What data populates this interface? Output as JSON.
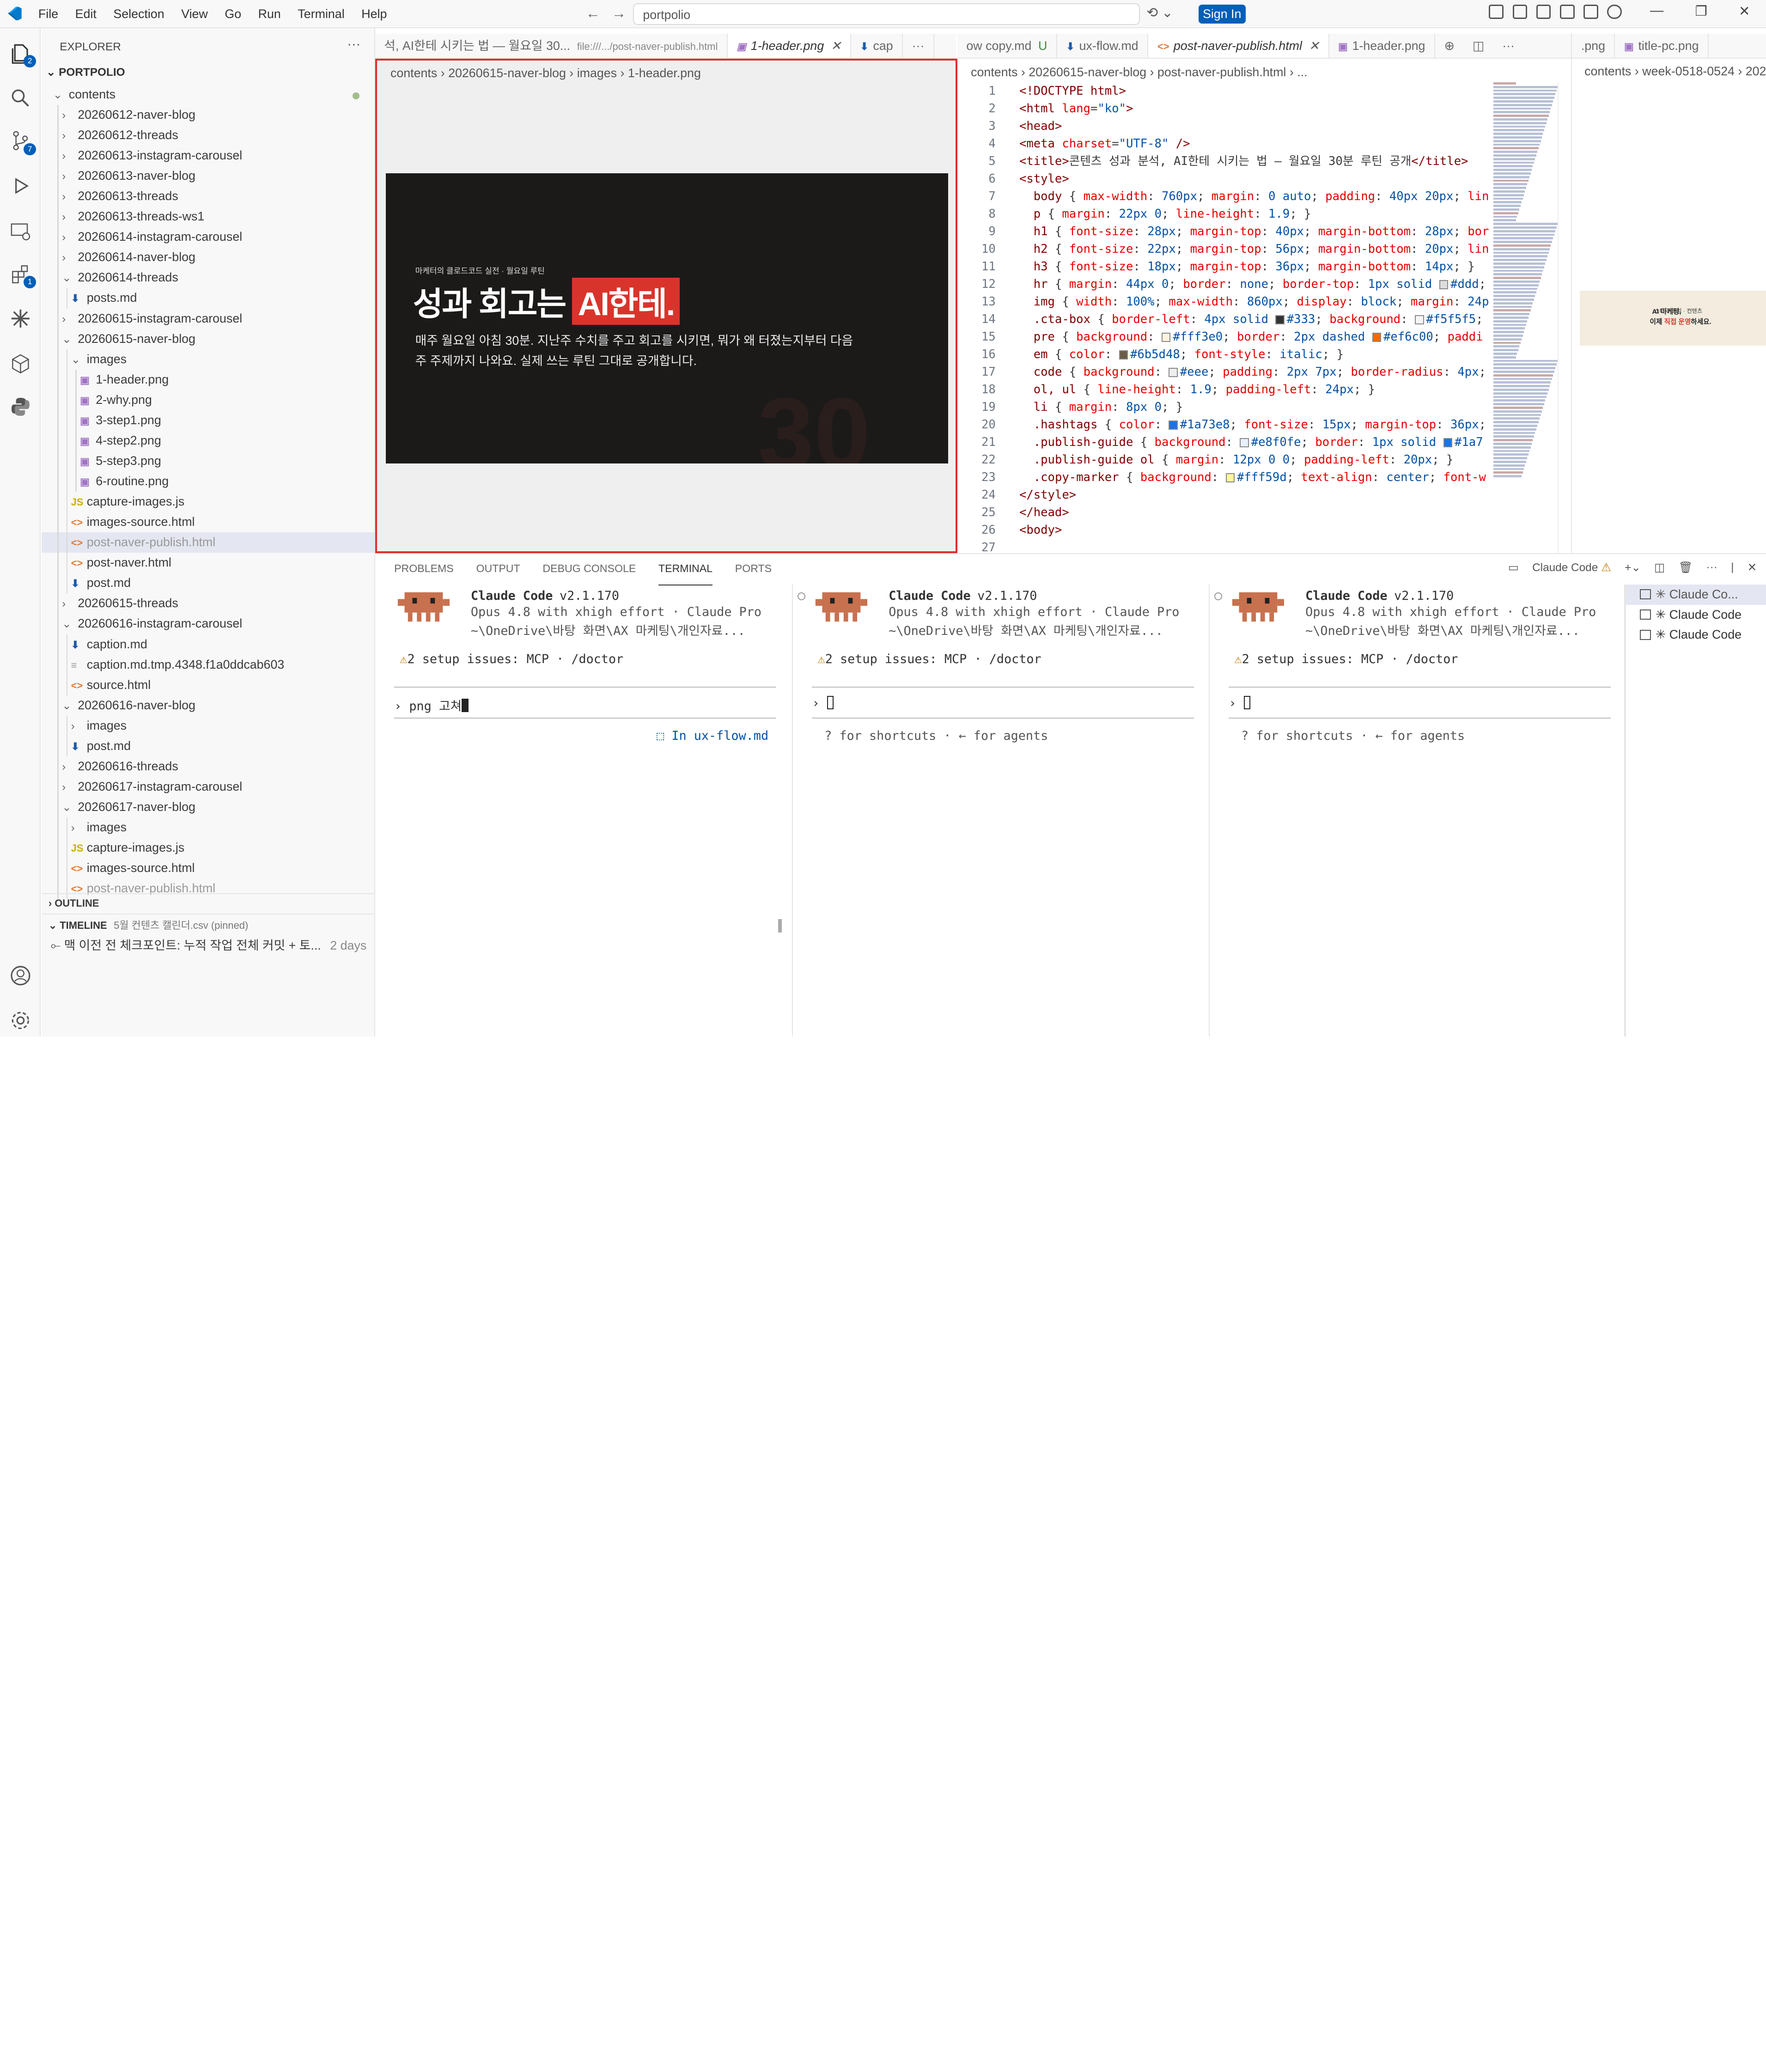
{
  "menu": [
    "File",
    "Edit",
    "Selection",
    "View",
    "Go",
    "Run",
    "Terminal",
    "Help"
  ],
  "command_center": "portpolio",
  "sign_in": "Sign In",
  "explorer": {
    "title": "EXPLORER",
    "root": "PORTPOLIO",
    "items": [
      {
        "label": "contents",
        "lvl": 0,
        "type": "folder",
        "open": true,
        "dot": true
      },
      {
        "label": "20260612-naver-blog",
        "lvl": 1,
        "type": "folder"
      },
      {
        "label": "20260612-threads",
        "lvl": 1,
        "type": "folder"
      },
      {
        "label": "20260613-instagram-carousel",
        "lvl": 1,
        "type": "folder"
      },
      {
        "label": "20260613-naver-blog",
        "lvl": 1,
        "type": "folder"
      },
      {
        "label": "20260613-threads",
        "lvl": 1,
        "type": "folder"
      },
      {
        "label": "20260613-threads-ws1",
        "lvl": 1,
        "type": "folder"
      },
      {
        "label": "20260614-instagram-carousel",
        "lvl": 1,
        "type": "folder"
      },
      {
        "label": "20260614-naver-blog",
        "lvl": 1,
        "type": "folder"
      },
      {
        "label": "20260614-threads",
        "lvl": 1,
        "type": "folder",
        "open": true
      },
      {
        "label": "posts.md",
        "lvl": 2,
        "type": "md"
      },
      {
        "label": "20260615-instagram-carousel",
        "lvl": 1,
        "type": "folder"
      },
      {
        "label": "20260615-naver-blog",
        "lvl": 1,
        "type": "folder",
        "open": true
      },
      {
        "label": "images",
        "lvl": 2,
        "type": "folder",
        "open": true
      },
      {
        "label": "1-header.png",
        "lvl": 3,
        "type": "img"
      },
      {
        "label": "2-why.png",
        "lvl": 3,
        "type": "img"
      },
      {
        "label": "3-step1.png",
        "lvl": 3,
        "type": "img"
      },
      {
        "label": "4-step2.png",
        "lvl": 3,
        "type": "img"
      },
      {
        "label": "5-step3.png",
        "lvl": 3,
        "type": "img"
      },
      {
        "label": "6-routine.png",
        "lvl": 3,
        "type": "img"
      },
      {
        "label": "capture-images.js",
        "lvl": 2,
        "type": "js"
      },
      {
        "label": "images-source.html",
        "lvl": 2,
        "type": "html"
      },
      {
        "label": "post-naver-publish.html",
        "lvl": 2,
        "type": "html",
        "sel": true,
        "dim": true
      },
      {
        "label": "post-naver.html",
        "lvl": 2,
        "type": "html"
      },
      {
        "label": "post.md",
        "lvl": 2,
        "type": "md"
      },
      {
        "label": "20260615-threads",
        "lvl": 1,
        "type": "folder"
      },
      {
        "label": "20260616-instagram-carousel",
        "lvl": 1,
        "type": "folder",
        "open": true
      },
      {
        "label": "caption.md",
        "lvl": 2,
        "type": "md"
      },
      {
        "label": "caption.md.tmp.4348.f1a0ddcab603",
        "lvl": 2,
        "type": "tmp"
      },
      {
        "label": "source.html",
        "lvl": 2,
        "type": "html"
      },
      {
        "label": "20260616-naver-blog",
        "lvl": 1,
        "type": "folder",
        "open": true
      },
      {
        "label": "images",
        "lvl": 2,
        "type": "folder"
      },
      {
        "label": "post.md",
        "lvl": 2,
        "type": "md"
      },
      {
        "label": "20260616-threads",
        "lvl": 1,
        "type": "folder"
      },
      {
        "label": "20260617-instagram-carousel",
        "lvl": 1,
        "type": "folder"
      },
      {
        "label": "20260617-naver-blog",
        "lvl": 1,
        "type": "folder",
        "open": true
      },
      {
        "label": "images",
        "lvl": 2,
        "type": "folder"
      },
      {
        "label": "capture-images.js",
        "lvl": 2,
        "type": "js"
      },
      {
        "label": "images-source.html",
        "lvl": 2,
        "type": "html"
      },
      {
        "label": "post-naver-publish.html",
        "lvl": 2,
        "type": "html",
        "dim": true
      }
    ],
    "outline": "OUTLINE",
    "timeline": {
      "title": "TIMELINE",
      "file": "5월 컨텐츠 캘린더.csv (pinned)",
      "entry": "맥 이전 전 체크포인트: 누적 작업 전체 커밋 + 토...",
      "when": "2 days"
    }
  },
  "editor1": {
    "tabs": [
      {
        "label": "석, AI한테 시키는 법 — 월요일 30...",
        "extra": "file:///.../post-naver-publish.html",
        "icon": ""
      },
      {
        "label": "1-header.png",
        "icon": "▣",
        "active": true,
        "close": "✕"
      },
      {
        "label": "cap",
        "icon": "⬇"
      }
    ],
    "more": "···",
    "breadcrumb": [
      "contents",
      "20260615-naver-blog",
      "images",
      "1-header.png"
    ],
    "image": {
      "small": "마케터의 클로드코드 실전 · 월요일 루틴",
      "headline": "성과 회고는",
      "highlight": "AI한테.",
      "desc": "매주 월요일 아침 30분. 지난주 수치를 주고 회고를 시키면, 뭐가 왜 터졌는지부터 다음 주 주제까지 나와요. 실제 쓰는 루틴 그대로 공개합니다.",
      "bg": "30"
    }
  },
  "editor2": {
    "tabs": [
      {
        "label": "ow copy.md",
        "badge": "U"
      },
      {
        "label": "ux-flow.md",
        "icon": "⬇"
      },
      {
        "label": "post-naver-publish.html",
        "icon": "<>",
        "active": true,
        "close": "✕"
      },
      {
        "label": "1-header.png",
        "icon": "▣"
      }
    ],
    "breadcrumb": [
      "contents",
      "20260615-naver-blog",
      "post-naver-publish.html",
      "..."
    ],
    "lines": [
      {
        "n": "1",
        "h": "<span class='k'>&lt;!DOCTYPE html&gt;</span>"
      },
      {
        "n": "2",
        "h": "<span class='k'>&lt;html</span> <span class='a'>lang</span>=<span class='s'>\"ko\"</span><span class='k'>&gt;</span>"
      },
      {
        "n": "3",
        "h": "<span class='k'>&lt;head&gt;</span>"
      },
      {
        "n": "4",
        "h": "<span class='k'>&lt;meta</span> <span class='a'>charset</span>=<span class='s'>\"UTF-8\"</span> <span class='k'>/&gt;</span>"
      },
      {
        "n": "5",
        "h": "<span class='k'>&lt;title&gt;</span>콘텐츠 성과 분석, AI한테 시키는 법 — 월요일 30분 루틴 공개<span class='k'>&lt;/title&gt;</span>"
      },
      {
        "n": "6",
        "h": "<span class='k'>&lt;style&gt;</span>"
      },
      {
        "n": "7",
        "h": "  <span class='sel2'>body</span> { <span class='pr'>max-width</span>: <span class='v'>760px</span>; <span class='pr'>margin</span>: <span class='v'>0 auto</span>; <span class='pr'>padding</span>: <span class='v'>40px 20px</span>; <span class='pr'>lin</span>"
      },
      {
        "n": "8",
        "h": "  <span class='sel2'>p</span> { <span class='pr'>margin</span>: <span class='v'>22px 0</span>; <span class='pr'>line-height</span>: <span class='v'>1.9</span>; }"
      },
      {
        "n": "9",
        "h": "  <span class='sel2'>h1</span> { <span class='pr'>font-size</span>: <span class='v'>28px</span>; <span class='pr'>margin-top</span>: <span class='v'>40px</span>; <span class='pr'>margin-bottom</span>: <span class='v'>28px</span>; <span class='pr'>bor</span>"
      },
      {
        "n": "10",
        "h": "  <span class='sel2'>h2</span> { <span class='pr'>font-size</span>: <span class='v'>22px</span>; <span class='pr'>margin-top</span>: <span class='v'>56px</span>; <span class='pr'>margin-bottom</span>: <span class='v'>20px</span>; <span class='pr'>lin</span>"
      },
      {
        "n": "11",
        "h": "  <span class='sel2'>h3</span> { <span class='pr'>font-size</span>: <span class='v'>18px</span>; <span class='pr'>margin-top</span>: <span class='v'>36px</span>; <span class='pr'>margin-bottom</span>: <span class='v'>14px</span>; }"
      },
      {
        "n": "12",
        "h": "  <span class='sel2'>hr</span> { <span class='pr'>margin</span>: <span class='v'>44px 0</span>; <span class='pr'>border</span>: <span class='v'>none</span>; <span class='pr'>border-top</span>: <span class='v'>1px solid</span> <i class='sw' style='background:#ddd'></i><span class='v'>#ddd</span>;"
      },
      {
        "n": "13",
        "h": "  <span class='sel2'>img</span> { <span class='pr'>width</span>: <span class='v'>100%</span>; <span class='pr'>max-width</span>: <span class='v'>860px</span>; <span class='pr'>display</span>: <span class='v'>block</span>; <span class='pr'>margin</span>: <span class='v'>24p</span>"
      },
      {
        "n": "14",
        "h": "  <span class='sel2'>.cta-box</span> { <span class='pr'>border-left</span>: <span class='v'>4px solid</span> <i class='sw' style='background:#333'></i><span class='v'>#333</span>; <span class='pr'>background</span>: <i class='sw' style='background:#f5f5f5'></i><span class='v'>#f5f5f5</span>;"
      },
      {
        "n": "15",
        "h": "  <span class='sel2'>pre</span> { <span class='pr'>background</span>: <i class='sw' style='background:#fff3e0'></i><span class='v'>#fff3e0</span>; <span class='pr'>border</span>: <span class='v'>2px dashed</span> <i class='sw' style='background:#ef6c00'></i><span class='v'>#ef6c00</span>; <span class='pr'>paddi</span>"
      },
      {
        "n": "16",
        "h": "  <span class='sel2'>em</span> { <span class='pr'>color</span>: <i class='sw' style='background:#6b5d48'></i><span class='v'>#6b5d48</span>; <span class='pr'>font-style</span>: <span class='v'>italic</span>; }"
      },
      {
        "n": "17",
        "h": "  <span class='sel2'>code</span> { <span class='pr'>background</span>: <i class='sw' style='background:#eee'></i><span class='v'>#eee</span>; <span class='pr'>padding</span>: <span class='v'>2px 7px</span>; <span class='pr'>border-radius</span>: <span class='v'>4px</span>;"
      },
      {
        "n": "18",
        "h": "  <span class='sel2'>ol, ul</span> { <span class='pr'>line-height</span>: <span class='v'>1.9</span>; <span class='pr'>padding-left</span>: <span class='v'>24px</span>; }"
      },
      {
        "n": "19",
        "h": "  <span class='sel2'>li</span> { <span class='pr'>margin</span>: <span class='v'>8px 0</span>; }"
      },
      {
        "n": "20",
        "h": "  <span class='sel2'>.hashtags</span> { <span class='pr'>color</span>: <i class='sw' style='background:#1a73e8'></i><span class='v'>#1a73e8</span>; <span class='pr'>font-size</span>: <span class='v'>15px</span>; <span class='pr'>margin-top</span>: <span class='v'>36px</span>;"
      },
      {
        "n": "21",
        "h": "  <span class='sel2'>.publish-guide</span> { <span class='pr'>background</span>: <i class='sw' style='background:#e8f0fe'></i><span class='v'>#e8f0fe</span>; <span class='pr'>border</span>: <span class='v'>1px solid</span> <i class='sw' style='background:#1a73e8'></i><span class='v'>#1a7</span>"
      },
      {
        "n": "22",
        "h": "  <span class='sel2'>.publish-guide ol</span> { <span class='pr'>margin</span>: <span class='v'>12px 0 0</span>; <span class='pr'>padding-left</span>: <span class='v'>20px</span>; }"
      },
      {
        "n": "23",
        "h": "  <span class='sel2'>.copy-marker</span> { <span class='pr'>background</span>: <i class='sw' style='background:#fff59d'></i><span class='v'>#fff59d</span>; <span class='pr'>text-align</span>: <span class='v'>center</span>; <span class='pr'>font-w</span>"
      },
      {
        "n": "24",
        "h": "<span class='k'>&lt;/style&gt;</span>"
      },
      {
        "n": "25",
        "h": "<span class='k'>&lt;/head&gt;</span>"
      },
      {
        "n": "26",
        "h": "<span class='k'>&lt;body&gt;</span>"
      },
      {
        "n": "27",
        "h": ""
      }
    ]
  },
  "editor3": {
    "tabs": [
      {
        "label": ".png"
      },
      {
        "label": "title-pc.png",
        "icon": "▣"
      }
    ],
    "breadcrumb": [
      "contents",
      "week-0518-0524",
      "202"
    ],
    "thumb_small": "스터디 모임 · 컨텐츠",
    "thumb_a": "AI 마케팅,",
    "thumb_b": "이제 ",
    "thumb_c": "직접 운영",
    "thumb_d": "하세요."
  },
  "panel": {
    "tabs": [
      "PROBLEMS",
      "OUTPUT",
      "DEBUG CONSOLE",
      "TERMINAL",
      "PORTS"
    ],
    "active_terminal": "Claude Code",
    "terminals": [
      {
        "version_name": "Claude Code",
        "version": "v2.1.170",
        "model": "Opus 4.8 with xhigh effort · Claude Pro",
        "path": "~\\OneDrive\\바탕 화면\\AX 마케팅\\개인자료...",
        "warn_icon": "⚠",
        "warn": "2 setup issues: MCP · /doctor",
        "prompt": "png 고쳐",
        "hint": "In ux-flow.md",
        "hint_icon": "⬚"
      },
      {
        "version_name": "Claude Code",
        "version": "v2.1.170",
        "model": "Opus 4.8 with xhigh effort · Claude Pro",
        "path": "~\\OneDrive\\바탕 화면\\AX 마케팅\\개인자료...",
        "warn_icon": "⚠",
        "warn": "2 setup issues: MCP · /doctor",
        "prompt": "",
        "hint": "? for shortcuts · ← for agents"
      },
      {
        "version_name": "Claude Code",
        "version": "v2.1.170",
        "model": "Opus 4.8 with xhigh effort · Claude Pro",
        "path": "~\\OneDrive\\바탕 화면\\AX 마케팅\\개인자료...",
        "warn_icon": "⚠",
        "warn": "2 setup issues: MCP · /doctor",
        "prompt": "",
        "hint": "? for shortcuts · ← for agents"
      }
    ],
    "term_list": [
      "✳ Claude Co...",
      "✳ Claude Code",
      "✳ Claude Code"
    ]
  },
  "colors": {
    "accent": "#005fb8",
    "highlight_red": "#d9342b",
    "robot": "#c8714f"
  }
}
